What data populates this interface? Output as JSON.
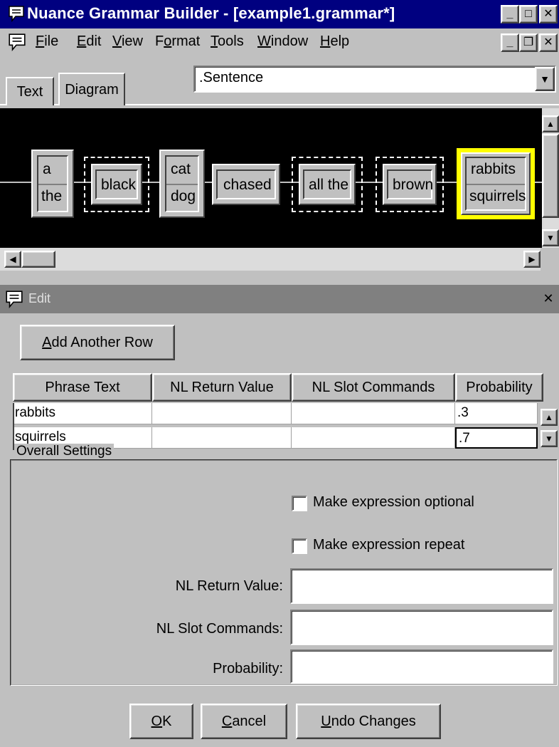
{
  "window": {
    "title": "Nuance Grammar Builder - [example1.grammar*]",
    "buttons": {
      "minimize": "_",
      "maximize": "□",
      "close": "✕"
    }
  },
  "menu": {
    "items": [
      {
        "label": "File",
        "u": "F",
        "rest": "ile"
      },
      {
        "label": "Edit",
        "u": "E",
        "rest": "dit"
      },
      {
        "label": "View",
        "u": "V",
        "rest": "iew"
      },
      {
        "label": "Format",
        "pre": "F",
        "u": "o",
        "rest": "rmat"
      },
      {
        "label": "Tools",
        "u": "T",
        "rest": "ools"
      },
      {
        "label": "Window",
        "u": "W",
        "rest": "indow"
      },
      {
        "label": "Help",
        "u": "H",
        "rest": "elp"
      }
    ],
    "mdi_buttons": {
      "minimize": "_",
      "restore": "❐",
      "close": "✕"
    }
  },
  "tabs": [
    {
      "label": "Text"
    },
    {
      "label": "Diagram"
    }
  ],
  "rule_combo": {
    "value": ".Sentence"
  },
  "diagram": {
    "nodes": [
      {
        "words": [
          "a",
          "the"
        ]
      },
      {
        "words": [
          "black"
        ]
      },
      {
        "words": [
          "cat",
          "dog"
        ]
      },
      {
        "words": [
          "chased"
        ]
      },
      {
        "words": [
          "all the"
        ]
      },
      {
        "words": [
          "brown"
        ]
      },
      {
        "words": [
          "rabbits",
          "squirrels"
        ]
      }
    ],
    "selected_color": "#ffff00"
  },
  "edit_panel": {
    "title": "Edit",
    "add_row_button": {
      "u": "A",
      "rest": "dd Another Row"
    },
    "grid": {
      "headers": [
        "Phrase Text",
        "NL Return Value",
        "NL Slot Commands",
        "Probability"
      ],
      "rows": [
        {
          "phrase": "rabbits",
          "nl_return": "",
          "nl_slot": "",
          "probability": ".3"
        },
        {
          "phrase": "squirrels",
          "nl_return": "",
          "nl_slot": "",
          "probability": ".7"
        }
      ]
    },
    "settings": {
      "group_label": "Overall Settings",
      "optional_label": "Make expression optional",
      "repeat_label": "Make expression repeat",
      "nl_return_label": "NL Return Value:",
      "nl_slot_label": "NL Slot Commands:",
      "probability_label": "Probability:"
    },
    "buttons": {
      "ok": {
        "u": "O",
        "rest": "K"
      },
      "cancel": {
        "u": "C",
        "rest": "ancel"
      },
      "undo": {
        "u": "U",
        "rest": "ndo Changes"
      }
    }
  }
}
